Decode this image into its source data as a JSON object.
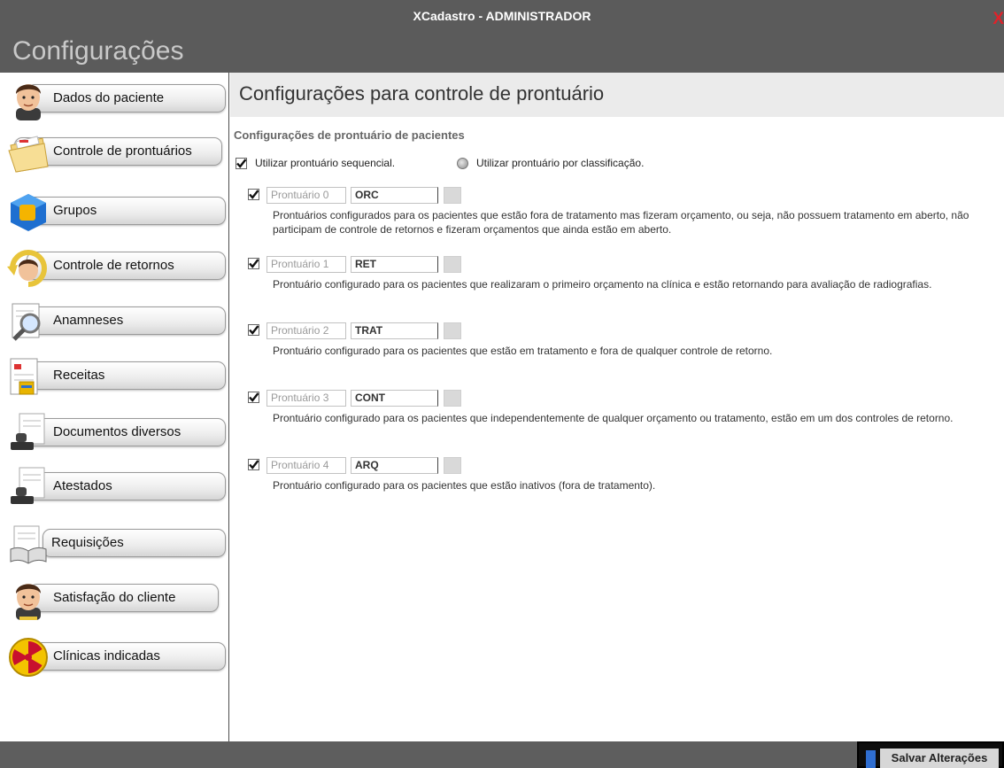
{
  "window": {
    "title": "XCadastro - ADMINISTRADOR",
    "close_glyph": "X",
    "heading": "Configurações"
  },
  "sidebar": {
    "items": [
      {
        "label": "Dados do paciente",
        "icon": "man-avatar-icon"
      },
      {
        "label": "Controle de prontuários",
        "icon": "folder-icon",
        "active": true
      },
      {
        "label": "Grupos",
        "icon": "cube-icon"
      },
      {
        "label": "Controle de retornos",
        "icon": "return-arrow-icon"
      },
      {
        "label": "Anamneses",
        "icon": "magnifier-icon"
      },
      {
        "label": "Receitas",
        "icon": "prescription-icon"
      },
      {
        "label": "Documentos diversos",
        "icon": "stamp-icon"
      },
      {
        "label": "Atestados",
        "icon": "stamp-icon"
      },
      {
        "label": "Requisições",
        "icon": "book-icon"
      },
      {
        "label": "Satisfação do cliente",
        "icon": "man-avatar-icon"
      },
      {
        "label": "Clínicas indicadas",
        "icon": "radiation-icon"
      }
    ]
  },
  "main": {
    "title": "Configurações para controle de prontuário",
    "section_title": "Configurações de prontuário de pacientes",
    "options": {
      "sequential": {
        "label": "Utilizar prontuário sequencial.",
        "checked": true
      },
      "classification": {
        "label": "Utilizar prontuário por classificação.",
        "checked": false
      }
    },
    "prontuarios": [
      {
        "name": "Prontuário 0",
        "code": "ORC",
        "checked": true,
        "description": "Prontuários configurados para os pacientes que estão fora de tratamento mas fizeram orçamento, ou seja, não possuem tratamento em aberto, não participam de controle de retornos e fizeram orçamentos que ainda estão em aberto."
      },
      {
        "name": "Prontuário 1",
        "code": "RET",
        "checked": true,
        "description": "Prontuário configurado para os pacientes que realizaram o primeiro orçamento na clínica e estão retornando para avaliação de radiografias."
      },
      {
        "name": "Prontuário 2",
        "code": "TRAT",
        "checked": true,
        "description": "Prontuário configurado para os pacientes que estão em tratamento e fora de qualquer controle de retorno."
      },
      {
        "name": "Prontuário 3",
        "code": "CONT",
        "checked": true,
        "description": "Prontuário configurado para os pacientes que independentemente de qualquer orçamento ou tratamento, estão em um dos controles de retorno."
      },
      {
        "name": "Prontuário 4",
        "code": "ARQ",
        "checked": true,
        "description": "Prontuário configurado para os pacientes que estão inativos (fora de tratamento)."
      }
    ]
  },
  "footer": {
    "save_label": "Salvar Alterações"
  },
  "colors": {
    "titlebar": "#5b5b5b",
    "footer": "#5e5e5e",
    "close": "#e0222a",
    "save_accent": "#2f6ed1"
  }
}
